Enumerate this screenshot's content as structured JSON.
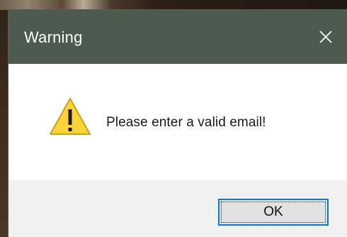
{
  "dialog": {
    "title": "Warning",
    "message": "Please enter a valid email!",
    "ok_label": "OK"
  },
  "icons": {
    "warning": "warning-icon",
    "close": "close-icon"
  },
  "colors": {
    "titlebar": "#4d5a4e",
    "warning_fill": "#ffd43b",
    "warning_border": "#d4a200",
    "button_focus": "#0a78d7",
    "footer": "#f0f0f0"
  }
}
